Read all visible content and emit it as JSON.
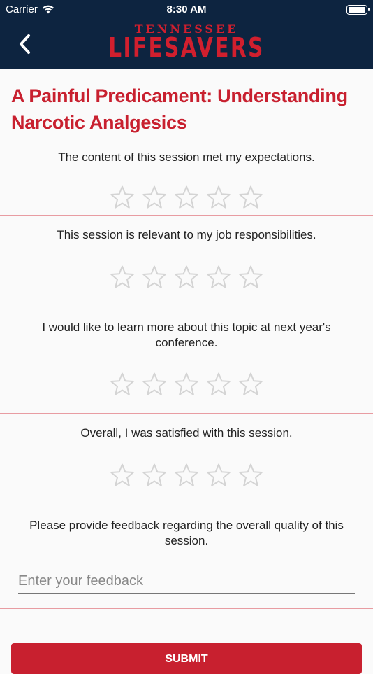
{
  "status_bar": {
    "carrier": "Carrier",
    "time": "8:30 AM"
  },
  "header": {
    "logo_top": "TENNESSEE",
    "logo_main": "LIFESAVERS"
  },
  "session": {
    "title": "A Painful Predicament: Understanding Narcotic Analgesics"
  },
  "questions": [
    {
      "text": "The content of this session met my expectations.",
      "rating": 0,
      "max": 5
    },
    {
      "text": "This session is relevant to my job responsibilities.",
      "rating": 0,
      "max": 5
    },
    {
      "text": "I would like to learn more about this topic at next year's conference.",
      "rating": 0,
      "max": 5
    },
    {
      "text": "Overall, I was satisfied with this session.",
      "rating": 0,
      "max": 5
    }
  ],
  "feedback": {
    "prompt": "Please provide feedback regarding the overall quality of this session.",
    "placeholder": "Enter your feedback",
    "value": ""
  },
  "submit_label": "SUBMIT",
  "colors": {
    "navy": "#0d2440",
    "red": "#c8202f",
    "divider": "#e89ca2",
    "star_outline": "#d4d4d4"
  }
}
